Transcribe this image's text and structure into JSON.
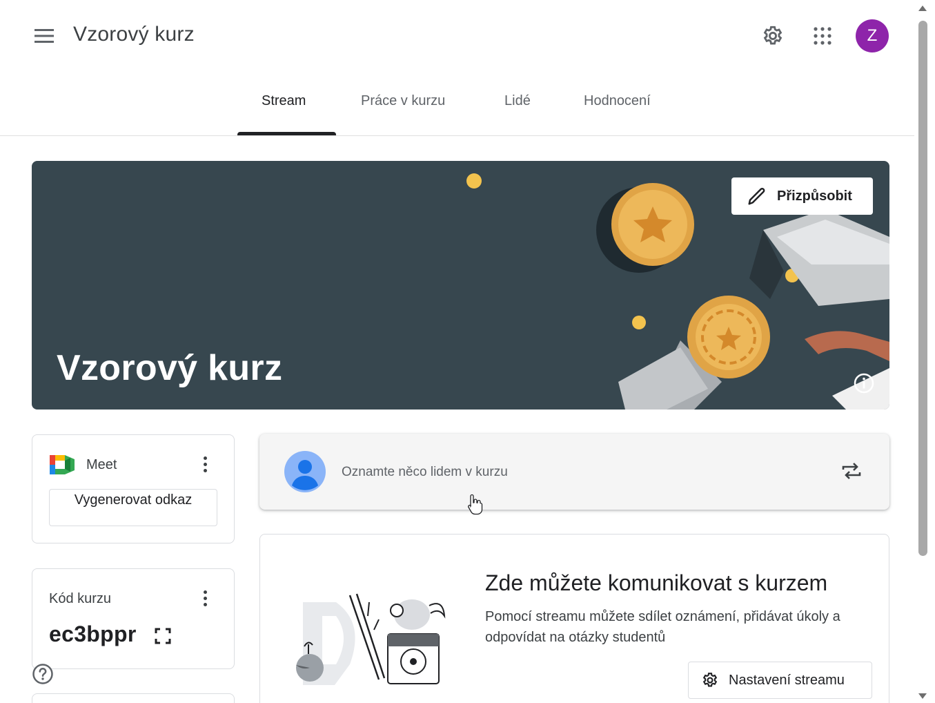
{
  "app": {
    "course_title": "Vzorový kurz",
    "avatar_initial": "Z",
    "avatar_color": "#8e24aa"
  },
  "tabs": [
    {
      "label": "Stream",
      "active": true
    },
    {
      "label": "Práce v kurzu",
      "active": false
    },
    {
      "label": "Lidé",
      "active": false
    },
    {
      "label": "Hodnocení",
      "active": false
    }
  ],
  "banner": {
    "title": "Vzorový kurz",
    "customize_label": "Přizpůsobit",
    "background_color": "#37474f"
  },
  "meet": {
    "label": "Meet",
    "generate_link_label": "Vygenerovat odkaz"
  },
  "class_code": {
    "label": "Kód kurzu",
    "value": "ec3bppr"
  },
  "announce": {
    "placeholder": "Oznamte něco lidem v kurzu"
  },
  "stream_empty": {
    "heading": "Zde můžete komunikovat s kurzem",
    "description": "Pomocí streamu můžete sdílet oznámení, přidávat úkoly a odpovídat na otázky studentů",
    "settings_label": "Nastavení streamu"
  },
  "icons": {
    "menu": "menu-icon",
    "settings": "gear-icon",
    "apps": "apps-grid-icon",
    "edit": "pencil-icon",
    "info": "info-icon",
    "meet": "meet-icon",
    "more": "more-vert-icon",
    "fullscreen": "fullscreen-icon",
    "help": "help-icon",
    "repost": "repost-icon"
  }
}
